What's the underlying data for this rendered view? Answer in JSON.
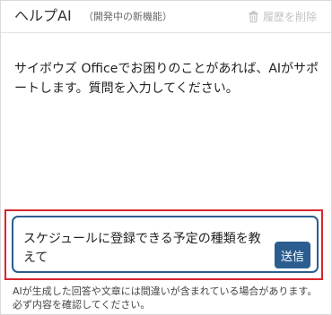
{
  "header": {
    "title": "ヘルプAI",
    "subtitle": "（開発中の新機能）",
    "clear_history_label": "履歴を削除",
    "clear_history_icon": "trash-icon"
  },
  "chat": {
    "assistant_message": "サイボウズ Officeでお困りのことがあれば、AIがサポートします。質問を入力してください。"
  },
  "input": {
    "value": "スケジュールに登録できる予定の種類を教えて",
    "send_label": "送信"
  },
  "footer": {
    "disclaimer": "AIが生成した回答や文章には間違いが含まれている場合があります。必ず内容を確認してください。"
  },
  "colors": {
    "accent": "#2b5d90",
    "highlight": "#d8252c",
    "disabled": "#c2c2c2"
  }
}
